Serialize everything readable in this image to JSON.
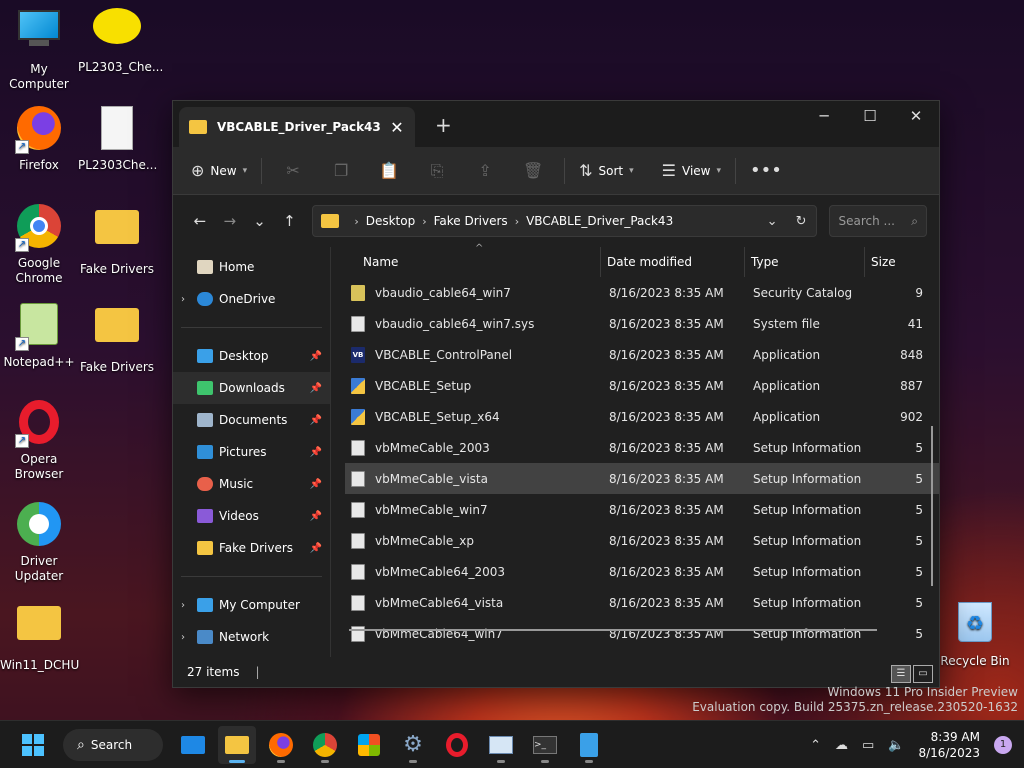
{
  "desktop": {
    "icons": [
      {
        "label": "My Computer"
      },
      {
        "label": "PL2303_Che..."
      },
      {
        "label": "Firefox"
      },
      {
        "label": "PL2303Che..."
      },
      {
        "label": "Google Chrome"
      },
      {
        "label": "Fake Drivers"
      },
      {
        "label": "Notepad++"
      },
      {
        "label": "Fake Drivers"
      },
      {
        "label": "Opera Browser"
      },
      {
        "label": "Driver Updater"
      },
      {
        "label": "Win11_DCHU"
      },
      {
        "label": "Recycle Bin"
      }
    ]
  },
  "window": {
    "tab_title": "VBCABLE_Driver_Pack43",
    "toolbar": {
      "new_label": "New",
      "sort_label": "Sort",
      "view_label": "View"
    },
    "breadcrumb": [
      "Desktop",
      "Fake Drivers",
      "VBCABLE_Driver_Pack43"
    ],
    "search_placeholder": "Search ...",
    "nav": [
      {
        "label": "Home"
      },
      {
        "label": "OneDrive"
      },
      {
        "label": "Desktop"
      },
      {
        "label": "Downloads"
      },
      {
        "label": "Documents"
      },
      {
        "label": "Pictures"
      },
      {
        "label": "Music"
      },
      {
        "label": "Videos"
      },
      {
        "label": "Fake Drivers"
      },
      {
        "label": "My Computer"
      },
      {
        "label": "Network"
      }
    ],
    "columns": {
      "name": "Name",
      "date": "Date modified",
      "type": "Type",
      "size": "Size"
    },
    "files": [
      {
        "name": "vbaudio_cable64_win7",
        "date": "8/16/2023 8:35 AM",
        "type": "Security Catalog",
        "size": "9"
      },
      {
        "name": "vbaudio_cable64_win7.sys",
        "date": "8/16/2023 8:35 AM",
        "type": "System file",
        "size": "41"
      },
      {
        "name": "VBCABLE_ControlPanel",
        "date": "8/16/2023 8:35 AM",
        "type": "Application",
        "size": "848"
      },
      {
        "name": "VBCABLE_Setup",
        "date": "8/16/2023 8:35 AM",
        "type": "Application",
        "size": "887"
      },
      {
        "name": "VBCABLE_Setup_x64",
        "date": "8/16/2023 8:35 AM",
        "type": "Application",
        "size": "902"
      },
      {
        "name": "vbMmeCable_2003",
        "date": "8/16/2023 8:35 AM",
        "type": "Setup Information",
        "size": "5"
      },
      {
        "name": "vbMmeCable_vista",
        "date": "8/16/2023 8:35 AM",
        "type": "Setup Information",
        "size": "5"
      },
      {
        "name": "vbMmeCable_win7",
        "date": "8/16/2023 8:35 AM",
        "type": "Setup Information",
        "size": "5"
      },
      {
        "name": "vbMmeCable_xp",
        "date": "8/16/2023 8:35 AM",
        "type": "Setup Information",
        "size": "5"
      },
      {
        "name": "vbMmeCable64_2003",
        "date": "8/16/2023 8:35 AM",
        "type": "Setup Information",
        "size": "5"
      },
      {
        "name": "vbMmeCable64_vista",
        "date": "8/16/2023 8:35 AM",
        "type": "Setup Information",
        "size": "5"
      },
      {
        "name": "vbMmeCable64_win7",
        "date": "8/16/2023 8:35 AM",
        "type": "Setup Information",
        "size": "5"
      }
    ],
    "status": "27 items"
  },
  "watermark": {
    "line1": "Windows 11 Pro Insider Preview",
    "line2": "Evaluation copy. Build 25375.zn_release.230520-1632"
  },
  "taskbar": {
    "search_label": "Search",
    "time": "8:39 AM",
    "date": "8/16/2023",
    "notification_count": "1"
  }
}
